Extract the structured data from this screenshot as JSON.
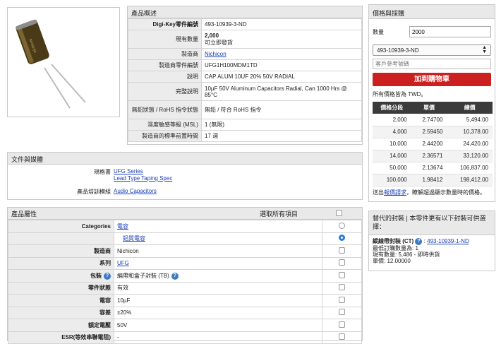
{
  "overview": {
    "title": "產品概述",
    "rows": [
      {
        "label": "Digi-Key零件編號",
        "value": "493-10939-3-ND",
        "bold_label": true
      },
      {
        "label": "現有數量",
        "value": "2,000",
        "value2": "可立即發貨"
      },
      {
        "label": "製造商",
        "value": "Nichicon",
        "link": true
      },
      {
        "label": "製造商零件編號",
        "value": "UFG1H100MDM1TD"
      },
      {
        "label": "說明",
        "value": "CAP ALUM 10UF 20% 50V RADIAL"
      },
      {
        "label": "完整說明",
        "value": "10µF 50V Aluminum Capacitors Radial, Can 1000 Hrs @ 85°C"
      },
      {
        "label": "無鉛狀態 / RoHS 指令狀態",
        "value": "無鉛 / 符合 RoHS 指令"
      },
      {
        "label": "濕度敏感等級 (MSL)",
        "value": "1 (無限)"
      },
      {
        "label": "製造商的標準前置時間",
        "value": "17 週"
      }
    ]
  },
  "media": {
    "title": "文件與媒體",
    "datasheet_label": "規格書",
    "datasheet_links": [
      "UFG Series",
      "Lead Type Taping Spec"
    ],
    "training_label": "產品培訓模組",
    "training_link": "Audio Capacitors"
  },
  "attributes": {
    "title": "產品屬性",
    "select_all": "選取所有項目",
    "rows": [
      {
        "label": "Categories",
        "value": "電容",
        "link": true,
        "control": "radio",
        "on": false
      },
      {
        "label": "",
        "value": "鋁質電容",
        "link": true,
        "control": "radio",
        "on": true,
        "indent": true
      },
      {
        "label": "製造商",
        "value": "Nichicon",
        "control": "check"
      },
      {
        "label": "系列",
        "value": "UFG",
        "link": true,
        "control": "check"
      },
      {
        "label": "包裝",
        "value": "編帶和盒子封裝 (TB)",
        "help": true,
        "control": "check"
      },
      {
        "label": "零件狀態",
        "value": "有效",
        "control": "check"
      },
      {
        "label": "電容",
        "value": "10µF",
        "control": "check"
      },
      {
        "label": "容差",
        "value": "±20%",
        "control": "check"
      },
      {
        "label": "額定電壓",
        "value": "50V",
        "control": "check"
      },
      {
        "label": "ESR(等效串聯電阻)",
        "value": "-",
        "control": "check"
      }
    ]
  },
  "pricing": {
    "title": "價格與採購",
    "qty_label": "數量",
    "qty_value": "2000",
    "part_select": "493-10939-3-ND",
    "ref_placeholder": "客戶參考號碼",
    "add_button": "加到購物車",
    "currency_note": "所有價格皆為 TWD。",
    "headers": [
      "價格分段",
      "單價",
      "總價"
    ],
    "rows": [
      [
        "2,000",
        "2.74700",
        "5,494.00"
      ],
      [
        "4,000",
        "2.59450",
        "10,378.00"
      ],
      [
        "10,000",
        "2.44200",
        "24,420.00"
      ],
      [
        "14,000",
        "2.36571",
        "33,120.00"
      ],
      [
        "50,000",
        "2.13674",
        "106,837.00"
      ],
      [
        "100,000",
        "1.98412",
        "198,412.00"
      ]
    ],
    "quote_prefix": "送出",
    "quote_link": "報價請求",
    "quote_suffix": "，瞭解超過顯示數量時的價格。"
  },
  "alternate": {
    "title": "替代的封裝 | 本零件更有以下封裝可供選擇：",
    "pkg_label": "縱線帶封裝 (CT)",
    "pkg_link": "493-10939-1-ND",
    "min_qty": "最低訂購數量為: 1",
    "stock": "現有數量: 5,486 - 即時供貨",
    "unit_price": "單價: 12.00000"
  },
  "colors": {
    "accent": "#cc1f1f",
    "link": "#1a3fb3",
    "header_dark": "#3b3b3b"
  }
}
